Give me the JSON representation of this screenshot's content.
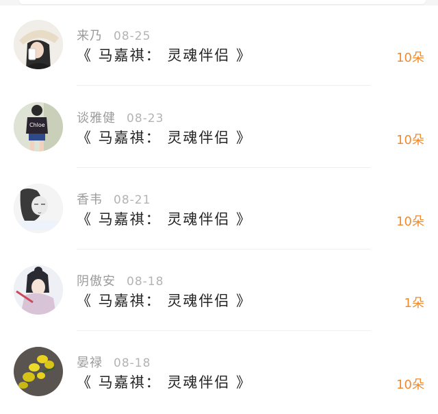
{
  "colors": {
    "accent": "#f08a2c",
    "name_text": "#9b9b9b",
    "title_text": "#222222"
  },
  "items": [
    {
      "name": "来乃",
      "date": "08-25",
      "title": "《 马嘉祺： 灵魂伴侣 》",
      "amount": "10朵",
      "avatar": "avatar-woman-hat"
    },
    {
      "name": "谈雅健",
      "date": "08-23",
      "title": "《 马嘉祺： 灵魂伴侣 》",
      "amount": "10朵",
      "avatar": "avatar-girl-chloe-tshirt"
    },
    {
      "name": "香韦",
      "date": "08-21",
      "title": "《 马嘉祺： 灵魂伴侣 》",
      "amount": "10朵",
      "avatar": "avatar-sketch-portrait"
    },
    {
      "name": "阴傲安",
      "date": "08-18",
      "title": "《 马嘉祺： 灵魂伴侣 》",
      "amount": "1朵",
      "avatar": "avatar-anime-character"
    },
    {
      "name": "晏禄",
      "date": "08-18",
      "title": "《 马嘉祺： 灵魂伴侣 》",
      "amount": "10朵",
      "avatar": "avatar-yellow-flowers"
    }
  ]
}
